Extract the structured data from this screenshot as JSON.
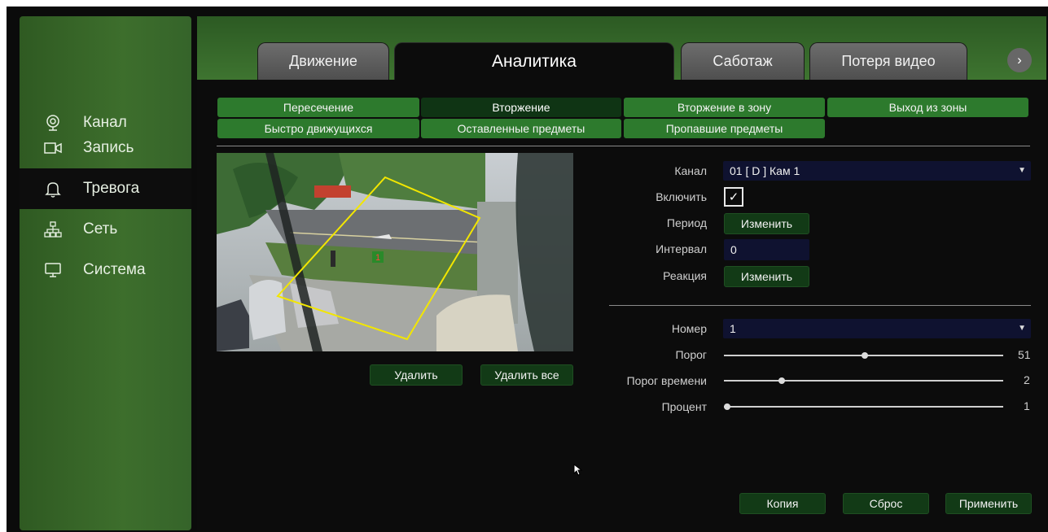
{
  "sidebar": {
    "items": [
      {
        "label": "Канал",
        "icon": "camera-lens-icon",
        "active": false
      },
      {
        "label": "Запись",
        "icon": "video-camera-icon",
        "active": false
      },
      {
        "label": "Тревога",
        "icon": "bell-icon",
        "active": true
      },
      {
        "label": "Сеть",
        "icon": "network-icon",
        "active": false
      },
      {
        "label": "Система",
        "icon": "monitor-icon",
        "active": false
      }
    ]
  },
  "tabs": [
    {
      "label": "Движение",
      "active": false
    },
    {
      "label": "Аналитика",
      "active": true
    },
    {
      "label": "Саботаж",
      "active": false
    },
    {
      "label": "Потеря видео",
      "active": false
    }
  ],
  "next_icon": "chevron-right-icon",
  "subtabs": [
    {
      "label": "Пересечение",
      "selected": false
    },
    {
      "label": "Вторжение",
      "selected": true
    },
    {
      "label": "Вторжение в зону",
      "selected": false
    },
    {
      "label": "Выход из зоны",
      "selected": false
    },
    {
      "label": "Быстро движущихся",
      "selected": false
    },
    {
      "label": "Оставленные предметы",
      "selected": false
    },
    {
      "label": "Пропавшие предметы",
      "selected": false
    }
  ],
  "preview": {
    "zone_label": "1",
    "delete_label": "Удалить",
    "delete_all_label": "Удалить все"
  },
  "form": {
    "channel_label": "Канал",
    "channel_value": "01 [ D ] Кам 1",
    "enable_label": "Включить",
    "enable_checked": true,
    "period_label": "Период",
    "period_button": "Изменить",
    "interval_label": "Интервал",
    "interval_value": "0",
    "reaction_label": "Реакция",
    "reaction_button": "Изменить",
    "number_label": "Номер",
    "number_value": "1",
    "threshold_label": "Порог",
    "threshold_value": "51",
    "time_threshold_label": "Порог времени",
    "time_threshold_value": "2",
    "percent_label": "Процент",
    "percent_value": "1"
  },
  "footer": {
    "copy_label": "Копия",
    "reset_label": "Сброс",
    "apply_label": "Применить"
  },
  "colors": {
    "sidebar_green": "#3d6e2c",
    "subtab_green": "#2d7a2d",
    "selected_dark": "#0f3414",
    "zone_yellow": "#f2e600"
  }
}
